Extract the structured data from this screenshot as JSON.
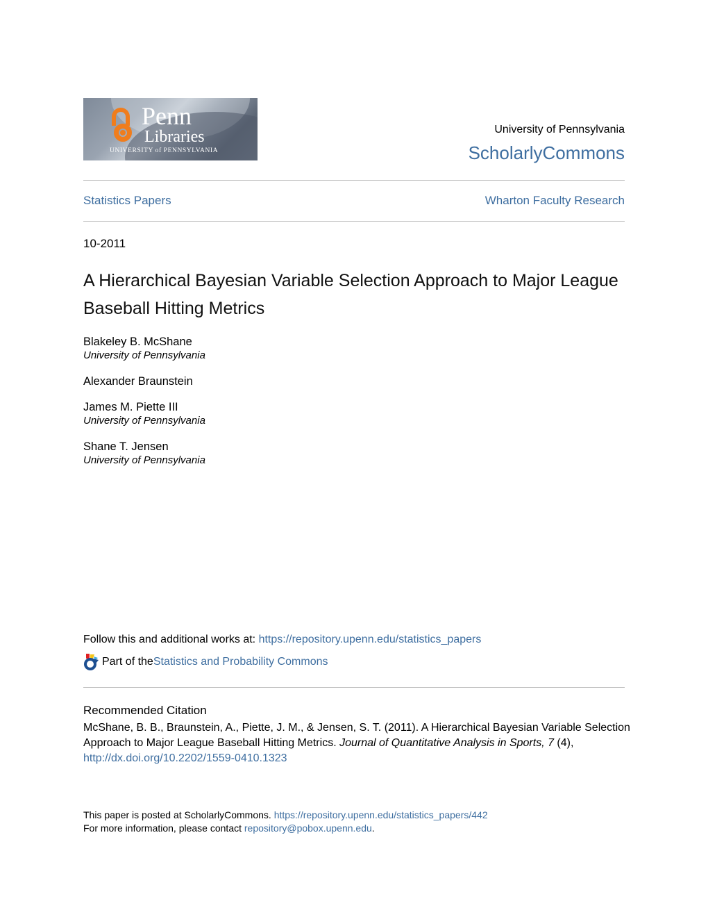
{
  "logo": {
    "line1": "Penn",
    "line2": "Libraries",
    "line3": "UNIVERSITY of PENNSYLVANIA",
    "accent_color": "#f07d1c"
  },
  "header": {
    "university": "University of Pennsylvania",
    "repository": "ScholarlyCommons"
  },
  "nav": {
    "left": "Statistics Papers",
    "right": "Wharton Faculty Research"
  },
  "paper": {
    "date": "10-2011",
    "title": "A Hierarchical Bayesian Variable Selection Approach to Major League Baseball Hitting Metrics",
    "authors": [
      {
        "name": "Blakeley B. McShane",
        "affiliation": "University of Pennsylvania"
      },
      {
        "name": "Alexander Braunstein",
        "affiliation": ""
      },
      {
        "name": "James M. Piette III",
        "affiliation": "University of Pennsylvania"
      },
      {
        "name": "Shane T. Jensen",
        "affiliation": "University of Pennsylvania"
      }
    ]
  },
  "links": {
    "follow_label": "Follow this and additional works at: ",
    "follow_url": "https://repository.upenn.edu/statistics_papers",
    "partof_label": "Part of the ",
    "partof_link": "Statistics and Probability Commons",
    "partof_icon": "bepress-commons-icon"
  },
  "citation": {
    "heading": "Recommended Citation",
    "text_plain": "McShane, B. B., Braunstein, A., Piette, J. M., & Jensen, S. T. (2011). A Hierarchical Bayesian Variable Selection Approach to Major League Baseball Hitting Metrics. ",
    "journal": "Journal of Quantitative Analysis in Sports, 7",
    "issue": " (4), ",
    "doi": "http://dx.doi.org/10.2202/1559-0410.1323"
  },
  "footer": {
    "posted_label": "This paper is posted at ScholarlyCommons. ",
    "posted_url": "https://repository.upenn.edu/statistics_papers/442",
    "contact_label": "For more information, please contact ",
    "contact_email": "repository@pobox.upenn.edu",
    "contact_end": "."
  },
  "colors": {
    "link": "#3e6ea0",
    "rule": "#bdbdbd"
  }
}
